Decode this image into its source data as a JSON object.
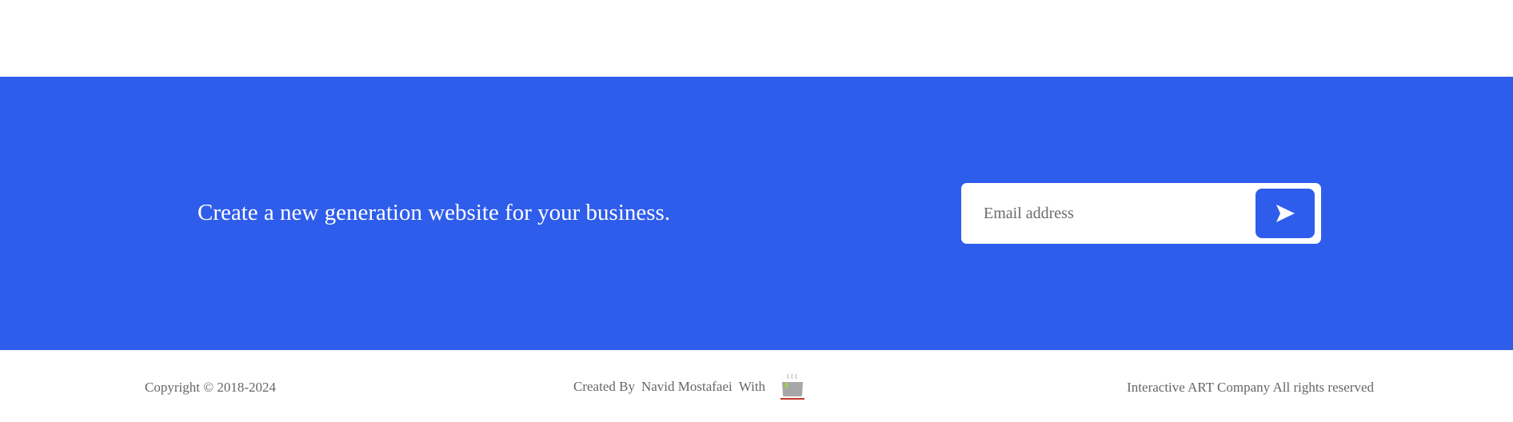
{
  "banner": {
    "tagline": "Create a new generation website for your business.",
    "background_color": "#2f5deb"
  },
  "subscribe": {
    "email_placeholder": "Email address",
    "submit_icon": "send-arrow-icon"
  },
  "footer": {
    "copyright": "Copyright © 2018-2024",
    "created_by_label": "Created By",
    "author": "Navid Mostafaei",
    "with_label": "With",
    "tea_icon": "tea-cup-icon",
    "rights": "Interactive ART Company All rights reserved"
  }
}
